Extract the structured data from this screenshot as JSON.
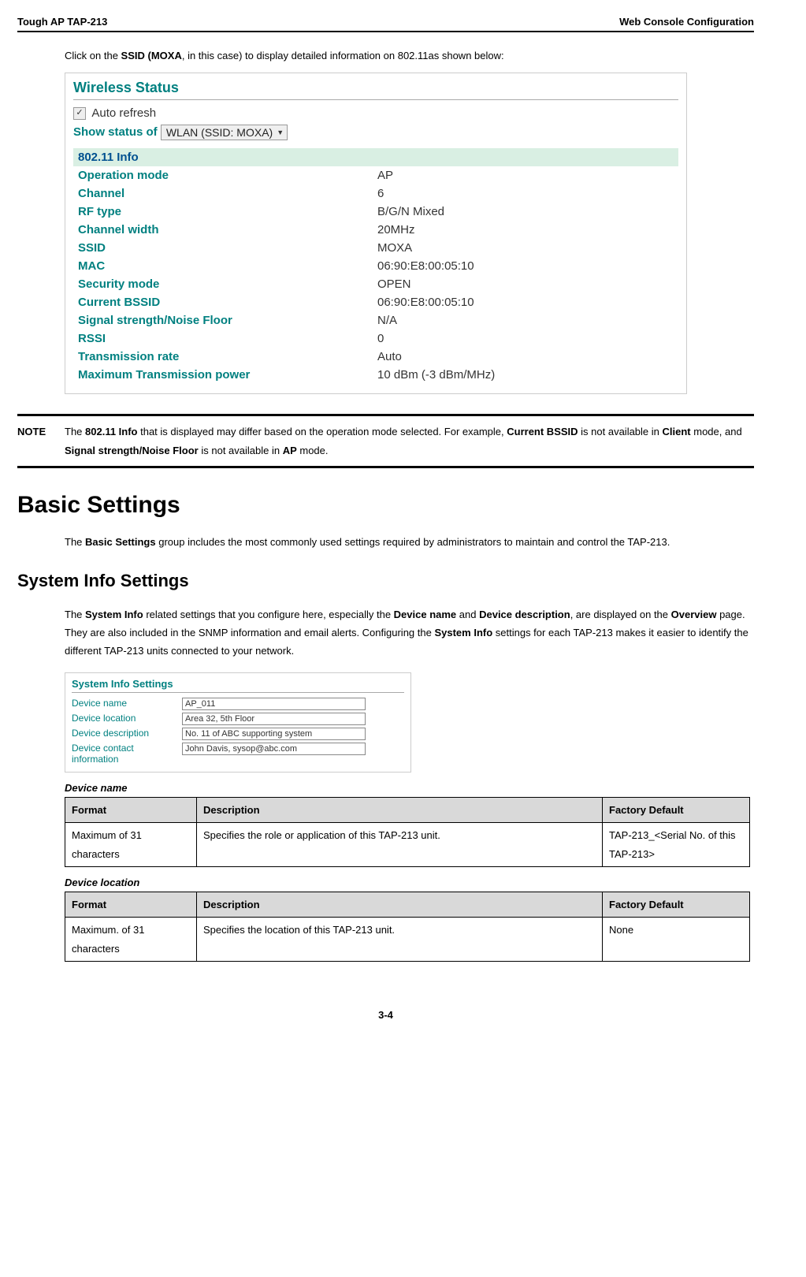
{
  "header": {
    "left": "Tough AP TAP-213",
    "right": "Web Console Configuration"
  },
  "intro": {
    "pre": "Click on the ",
    "bold": "SSID (MOXA",
    "post": ", in this case) to display detailed information on 802.11as shown below:"
  },
  "wireless_status": {
    "title": "Wireless Status",
    "auto_refresh_label": "Auto refresh",
    "show_status_label": "Show status of",
    "show_status_value": "WLAN (SSID: MOXA)",
    "info_header": "802.11 Info",
    "rows": [
      {
        "label": "Operation mode",
        "value": "AP"
      },
      {
        "label": "Channel",
        "value": "6"
      },
      {
        "label": "RF type",
        "value": "B/G/N Mixed"
      },
      {
        "label": "Channel width",
        "value": "20MHz"
      },
      {
        "label": "SSID",
        "value": "MOXA"
      },
      {
        "label": "MAC",
        "value": "06:90:E8:00:05:10"
      },
      {
        "label": "Security mode",
        "value": "OPEN"
      },
      {
        "label": "Current BSSID",
        "value": "06:90:E8:00:05:10"
      },
      {
        "label": "Signal strength/Noise Floor",
        "value": "N/A"
      },
      {
        "label": "RSSI",
        "value": "0"
      },
      {
        "label": "Transmission rate",
        "value": "Auto"
      },
      {
        "label": "Maximum Transmission power",
        "value": "10 dBm (-3 dBm/MHz)"
      }
    ]
  },
  "note": {
    "label": "NOTE",
    "p1": "The ",
    "b1": "802.11 Info",
    "p2": " that is displayed may differ based on the operation mode selected. For example, ",
    "b2": "Current BSSID",
    "p3": " is not available in ",
    "b3": "Client",
    "p4": " mode, and ",
    "b4": "Signal strength/Noise Floor",
    "p5": " is not available in ",
    "b5": "AP",
    "p6": " mode."
  },
  "basic": {
    "heading": "Basic Settings",
    "p1": "The ",
    "b1": "Basic Settings",
    "p2": " group includes the most commonly used settings required by administrators to maintain and control the TAP-213."
  },
  "sysinfo": {
    "heading": "System Info Settings",
    "p1": "The ",
    "b1": "System Info",
    "p2": " related settings that you configure here, especially the ",
    "b2": "Device name",
    "p3": " and ",
    "b3": "Device description",
    "p4": ", are displayed on the ",
    "b4": "Overview",
    "p5": " page. They are also included in the SNMP information and email alerts. Configuring the ",
    "b5": "System Info",
    "p6": " settings for each TAP-213 makes it easier to identify the different TAP-213 units connected to your network."
  },
  "sis_panel": {
    "title": "System Info Settings",
    "rows": [
      {
        "label": "Device name",
        "value": "AP_011"
      },
      {
        "label": "Device location",
        "value": "Area 32, 5th Floor"
      },
      {
        "label": "Device description",
        "value": "No. 11 of ABC supporting system"
      },
      {
        "label": "Device contact information",
        "value": "John Davis, sysop@abc.com"
      }
    ]
  },
  "tables": {
    "device_name": {
      "title": "Device name",
      "h1": "Format",
      "h2": "Description",
      "h3": "Factory Default",
      "c1": "Maximum of 31 characters",
      "c2": "Specifies the role or application of this TAP-213 unit.",
      "c3": "TAP-213_<Serial No. of this TAP-213>"
    },
    "device_location": {
      "title": "Device location",
      "h1": "Format",
      "h2": "Description",
      "h3": "Factory Default",
      "c1": "Maximum. of 31 characters",
      "c2": "Specifies the location of this TAP-213 unit.",
      "c3": "None"
    }
  },
  "page_num": "3-4"
}
